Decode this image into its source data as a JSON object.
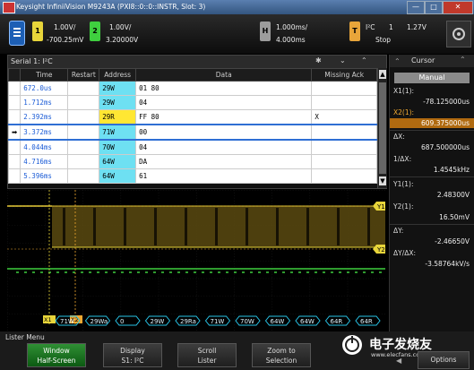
{
  "window": {
    "title": "Keysight InfiniiVision M9243A (PXI8::0::0::INSTR, Slot: 3)",
    "minimize": "—",
    "maximize": "□",
    "close": "✕"
  },
  "topbar": {
    "ch1": {
      "num": "1",
      "scale": "1.00V/",
      "offset": "-700.25mV",
      "color": "#e8d53a"
    },
    "ch2": {
      "num": "2",
      "scale": "1.00V/",
      "offset": "3.20000V",
      "color": "#3fcf3f"
    },
    "horizontal": {
      "badge": "H",
      "scale": "1.000ms/",
      "position": "4.000ms"
    },
    "trigger": {
      "badge": "T",
      "type": "I²C",
      "ch": "1",
      "state": "Stop",
      "level": "1.27V"
    }
  },
  "lister": {
    "title": "Serial 1: I²C",
    "columns": [
      "Time",
      "Restart",
      "Address",
      "Data",
      "Missing Ack"
    ],
    "rows": [
      {
        "time": "672.0us",
        "restart": "",
        "address": "29W",
        "data": "01 80",
        "ack": ""
      },
      {
        "time": "1.712ms",
        "restart": "",
        "address": "29W",
        "data": "04",
        "ack": ""
      },
      {
        "time": "2.392ms",
        "restart": "",
        "address": "29R",
        "data": "FF 80",
        "ack": "X"
      },
      {
        "time": "3.372ms",
        "restart": "",
        "address": "71W",
        "data": "00",
        "ack": ""
      },
      {
        "time": "4.044ms",
        "restart": "",
        "address": "70W",
        "data": "04",
        "ack": ""
      },
      {
        "time": "4.716ms",
        "restart": "",
        "address": "64W",
        "data": "DA",
        "ack": ""
      },
      {
        "time": "5.396ms",
        "restart": "",
        "address": "64W",
        "data": "61",
        "ack": ""
      }
    ],
    "selected_marker": "➡"
  },
  "cursor_panel": {
    "header": "Cursor",
    "mode": "Manual",
    "x1_label": "X1(1):",
    "x1_value": "-78.125000us",
    "x2_label": "X2(1):",
    "x2_value": "609.375000us",
    "dx_label": "ΔX:",
    "dx_value": "687.500000us",
    "inv_dx_label": "1/ΔX:",
    "inv_dx_value": "1.4545kHz",
    "y1_label": "Y1(1):",
    "y1_value": "2.48300V",
    "y2_label": "Y2(1):",
    "y2_value": "16.50mV",
    "dy_label": "ΔY:",
    "dy_value": "-2.46650V",
    "dydx_label": "ΔY/ΔX:",
    "dydx_value": "-3.58764kV/s",
    "colors": {
      "x2": "#f0a830",
      "mode_bg": "#8a8a8a"
    }
  },
  "waveform": {
    "decode_labels": [
      "71W",
      "29Wa",
      "0",
      "29W",
      "29Ra",
      "71W",
      "70W",
      "64W",
      "64W",
      "64R",
      "64R"
    ],
    "y1_marker": "Y1",
    "y2_marker": "Y2",
    "x1_marker": "X1",
    "x2_marker": "X2"
  },
  "menu": {
    "title": "Lister Menu",
    "buttons": [
      {
        "line1": "Window",
        "line2": "Half-Screen"
      },
      {
        "line1": "Display",
        "line2": "S1: I²C"
      },
      {
        "line1": "Scroll",
        "line2": "Lister"
      },
      {
        "line1": "Zoom to",
        "line2": "Selection"
      }
    ],
    "options": "Options",
    "watermark": "电子发烧友",
    "watermark_url": "www.elecfans.com"
  }
}
